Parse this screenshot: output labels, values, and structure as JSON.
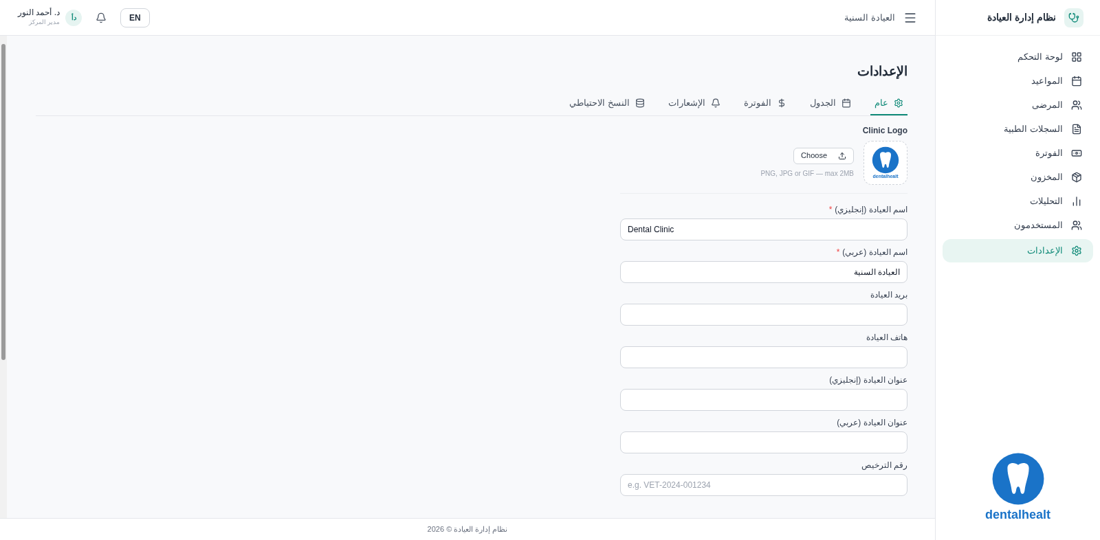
{
  "sidebar": {
    "title": "نظام إدارة العيادة",
    "items": [
      {
        "label": "لوحة التحكم",
        "selected": false
      },
      {
        "label": "المواعيد",
        "selected": false
      },
      {
        "label": "المرضى",
        "selected": false
      },
      {
        "label": "السجلات الطبية",
        "selected": false
      },
      {
        "label": "الفوترة",
        "selected": false
      },
      {
        "label": "المخزون",
        "selected": false
      },
      {
        "label": "التحليلات",
        "selected": false
      },
      {
        "label": "المستخدمون",
        "selected": false
      },
      {
        "label": "الإعدادات",
        "selected": true
      }
    ],
    "logo_text": "dentalhealt"
  },
  "header": {
    "clinic_name": "العيادة السنية",
    "language_button": "EN",
    "user": {
      "initials": "دأ",
      "name": "د. أحمد النور",
      "role": "مدير المركز"
    }
  },
  "page_title": "الإعدادات",
  "tabs": [
    {
      "label": "عام",
      "selected": true
    },
    {
      "label": "الجدول",
      "selected": false
    },
    {
      "label": "الفوترة",
      "selected": false
    },
    {
      "label": "الإشعارات",
      "selected": false
    },
    {
      "label": "النسخ الاحتياطي",
      "selected": false
    }
  ],
  "logo_section": {
    "label": "Clinic Logo",
    "button": "Choose",
    "hint": "PNG, JPG or GIF — max 2MB",
    "logo_text": "dentalhealt"
  },
  "fields": [
    {
      "label": "اسم العيادة (إنجليزي)",
      "required_mark": "*",
      "value": "Dental Clinic"
    },
    {
      "label": "اسم العيادة (عربي)",
      "required_mark": "*",
      "value": "العيادة السنية"
    },
    {
      "label": "بريد العيادة"
    },
    {
      "label": "هاتف العيادة"
    },
    {
      "label": "عنوان العيادة (إنجليزي)"
    },
    {
      "label": "عنوان العيادة (عربي)"
    },
    {
      "label": "رقم الترخيص",
      "placeholder": "e.g. VET-2024-001234"
    }
  ],
  "footer": "نظام إدارة العيادة © 2026"
}
